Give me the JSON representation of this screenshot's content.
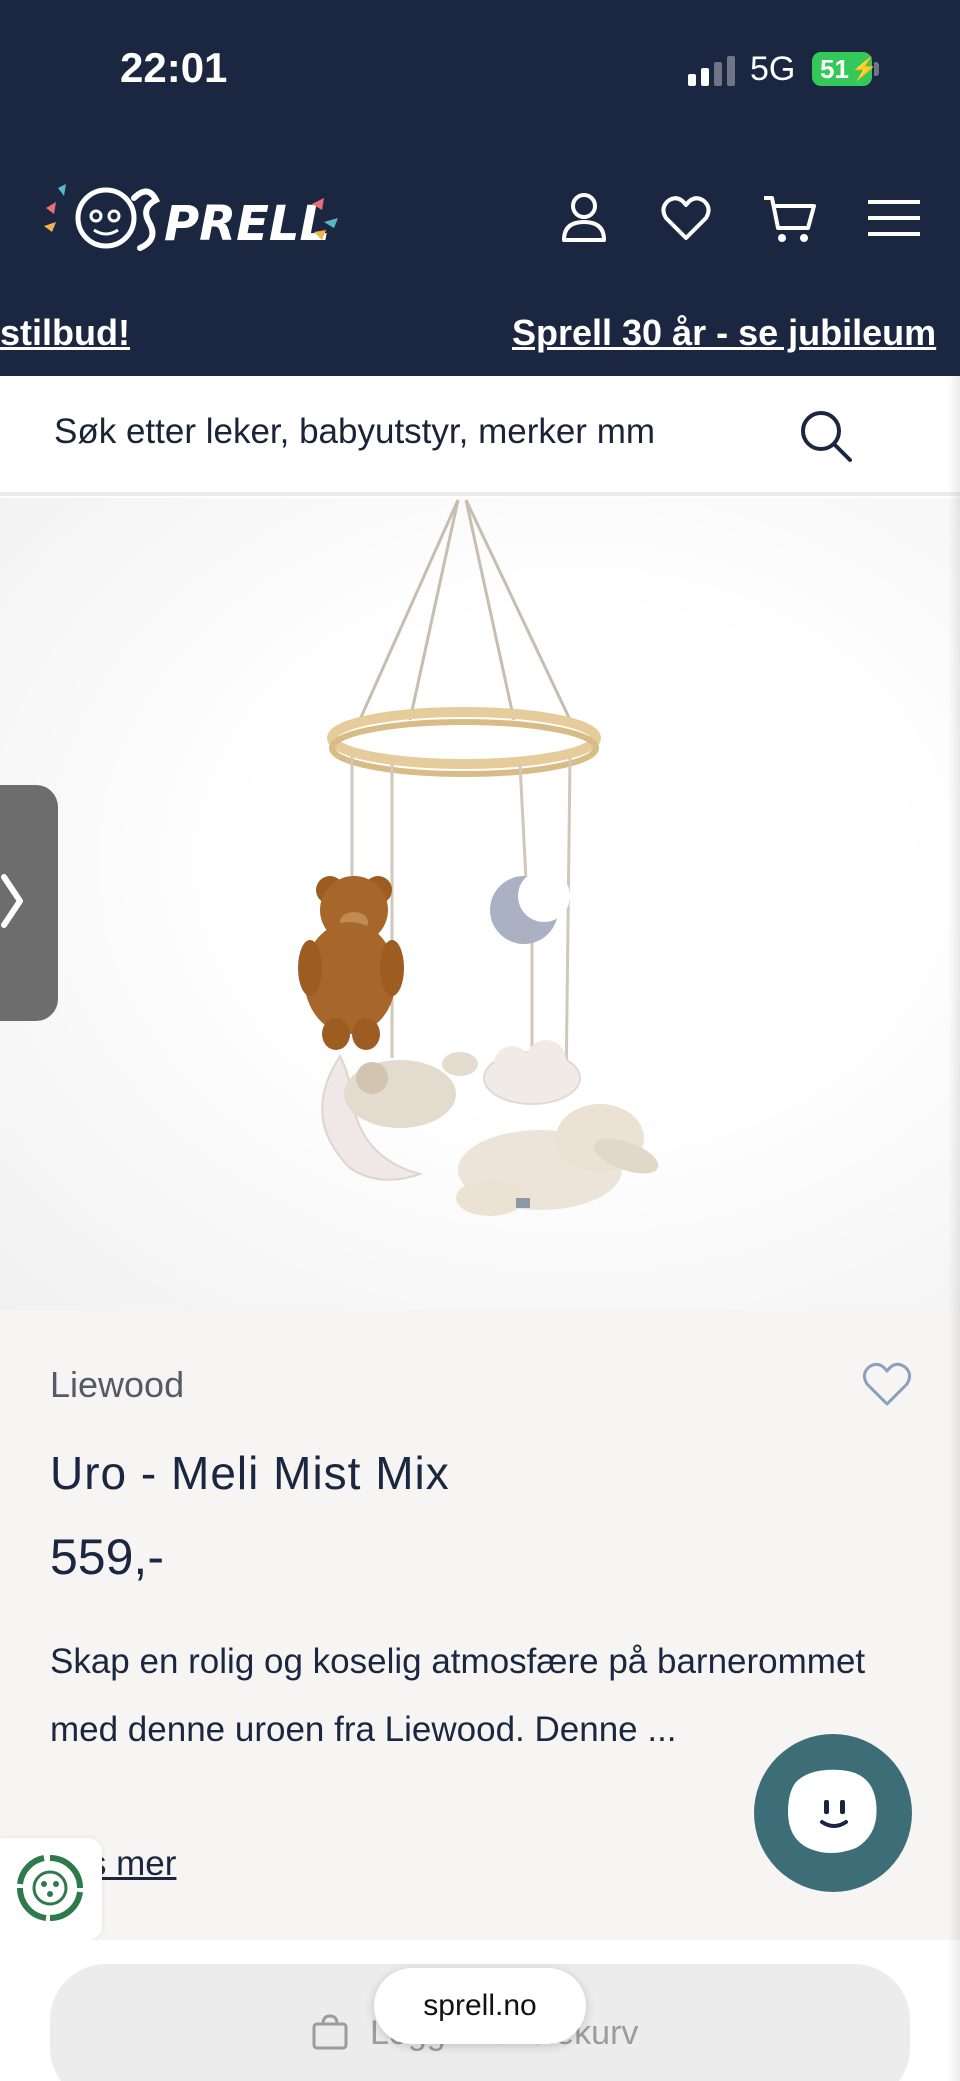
{
  "status_bar": {
    "time": "22:01",
    "network": "5G",
    "battery": "51"
  },
  "header": {
    "logo_text": "SPRELL",
    "icons": [
      "account-icon",
      "heart-icon",
      "cart-icon",
      "menu-icon"
    ]
  },
  "announcement": {
    "left_text": "stilbud!",
    "right_text": "Sprell 30 år - se jubileum"
  },
  "search": {
    "placeholder": "Søk etter leker, babyutstyr, merker mm"
  },
  "product": {
    "brand": "Liewood",
    "title": "Uro - Meli Mist Mix",
    "price": "559,-",
    "description": "Skap en rolig og koselig atmosfære på barnerommet med denne uroen fra Liewood. Denne ...",
    "read_more": "Les mer"
  },
  "cart": {
    "label": "Legg i handlekurv"
  },
  "browser": {
    "url": "sprell.no"
  },
  "colors": {
    "navy": "#1b2740",
    "chat": "#3d6e78",
    "battery": "#34c759"
  }
}
